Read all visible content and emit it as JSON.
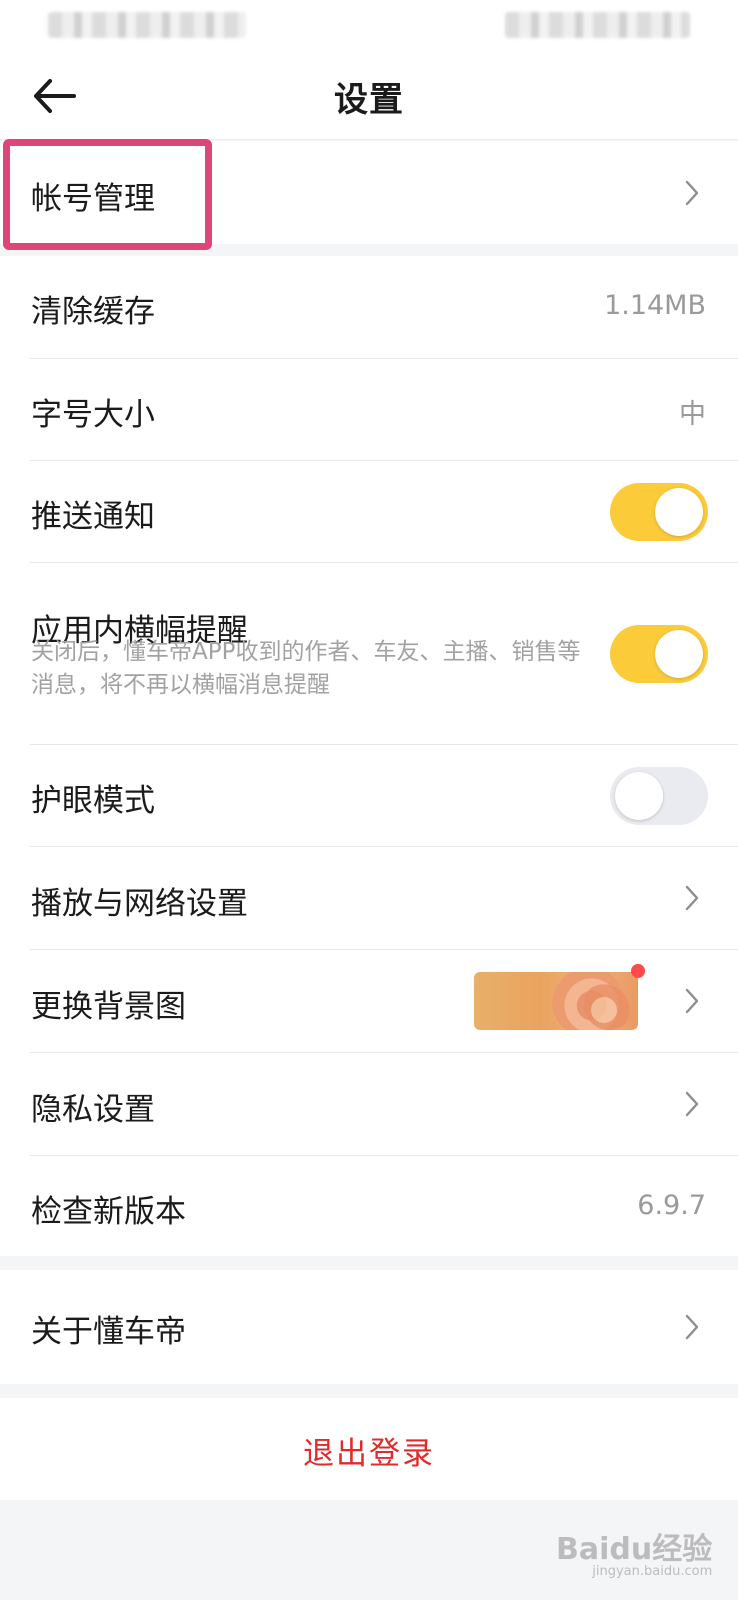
{
  "header": {
    "title": "设置"
  },
  "groups": [
    {
      "items": [
        {
          "label": "帐号管理"
        }
      ]
    },
    {
      "items": [
        {
          "label": "清除缓存",
          "value": "1.14MB"
        },
        {
          "label": "字号大小",
          "value": "中"
        },
        {
          "label": "推送通知",
          "toggle": true
        },
        {
          "label": "应用内横幅提醒",
          "description": "关闭后，懂车帝APP收到的作者、车友、主播、销售等消息，将不再以横幅消息提醒",
          "toggle": true
        },
        {
          "label": "护眼模式",
          "toggle": false
        },
        {
          "label": "播放与网络设置"
        },
        {
          "label": "更换背景图",
          "has_new_badge": true
        },
        {
          "label": "隐私设置"
        },
        {
          "label": "检查新版本",
          "value": "6.9.7"
        }
      ]
    },
    {
      "items": [
        {
          "label": "关于懂车帝"
        }
      ]
    }
  ],
  "logout_label": "退出登录",
  "watermark": {
    "text": "Baidu经验",
    "sub": "jingyan.baidu.com"
  },
  "colors": {
    "toggle_on": "#fccb3a",
    "toggle_off": "#e9ebf0",
    "logout": "#e12b2b",
    "highlight": "#e0457a"
  },
  "icons": [
    "back-arrow-icon",
    "chevron-right-icon"
  ]
}
